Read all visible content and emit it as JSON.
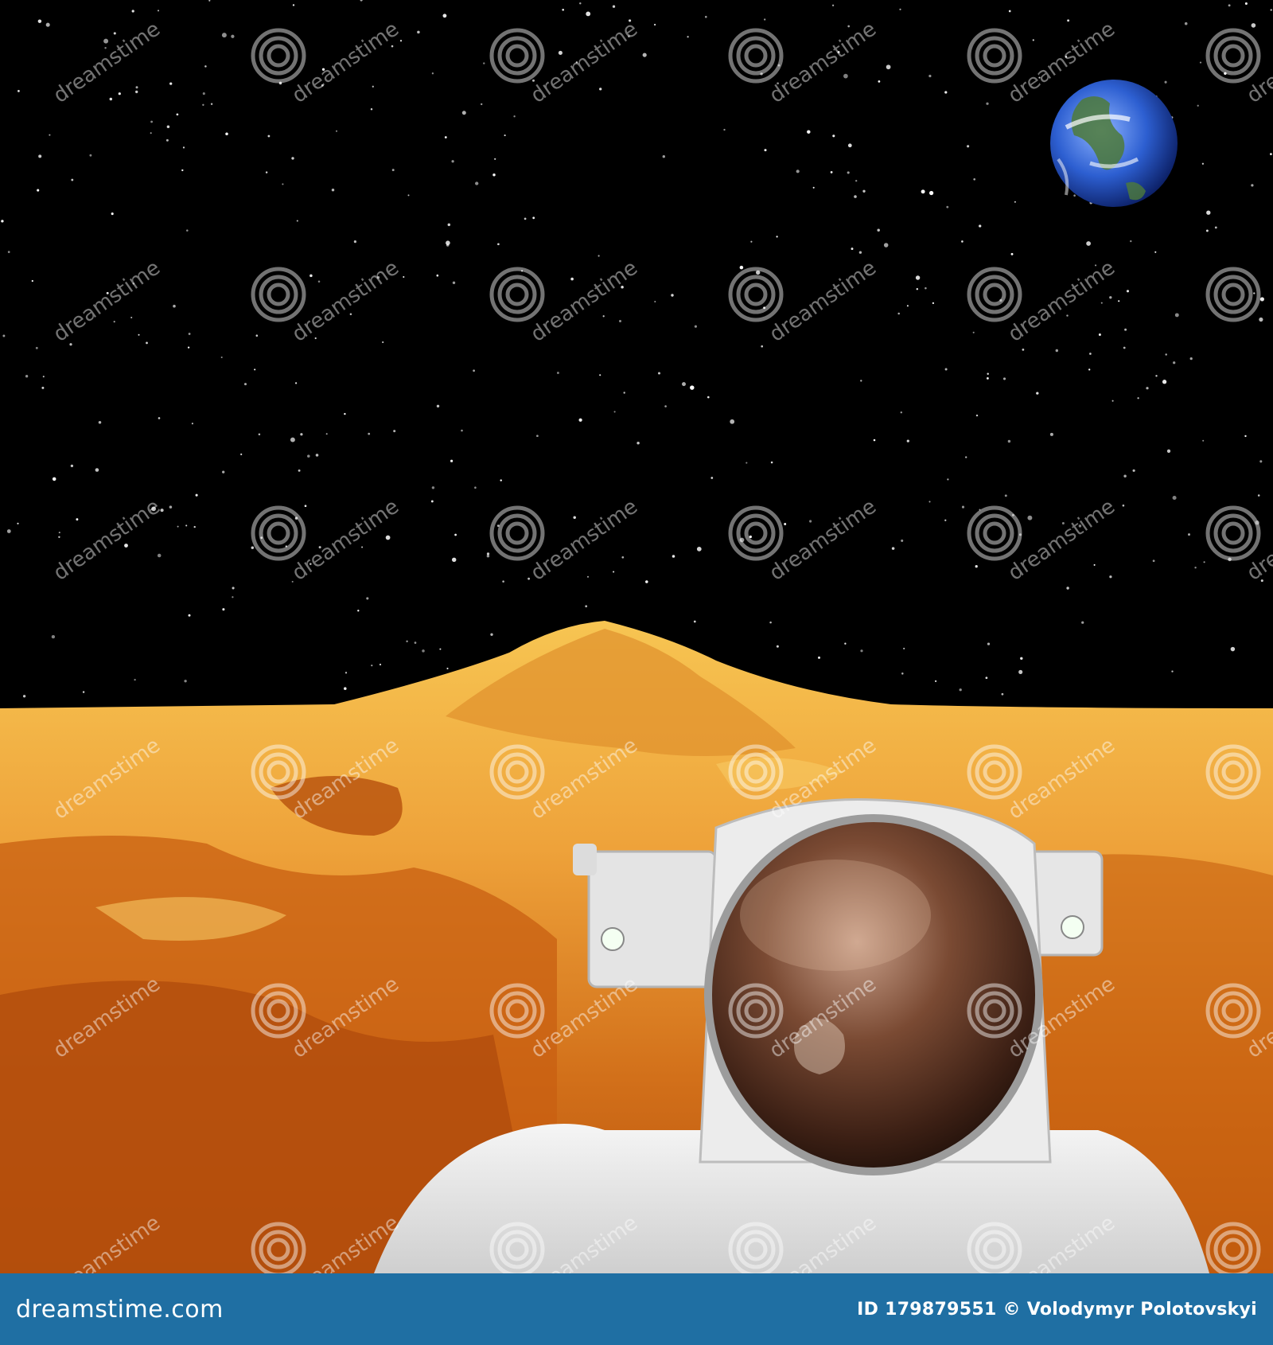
{
  "scene": {
    "watermark_text": "dreamstime",
    "colors": {
      "sky": "#000000",
      "terrain_light": "#f6c04a",
      "terrain_mid": "#e48a1c",
      "terrain_dark": "#a63d07",
      "suit": "#eeeeee",
      "visor": "#6b3b22",
      "earth_ocean": "#2d5fd1"
    }
  },
  "footer": {
    "brand": "dreamstime.com",
    "credit": "ID 179879551 © Volodymyr Polotovskyi",
    "colors": {
      "background": "#1f6fa3",
      "text": "#ffffff"
    }
  }
}
